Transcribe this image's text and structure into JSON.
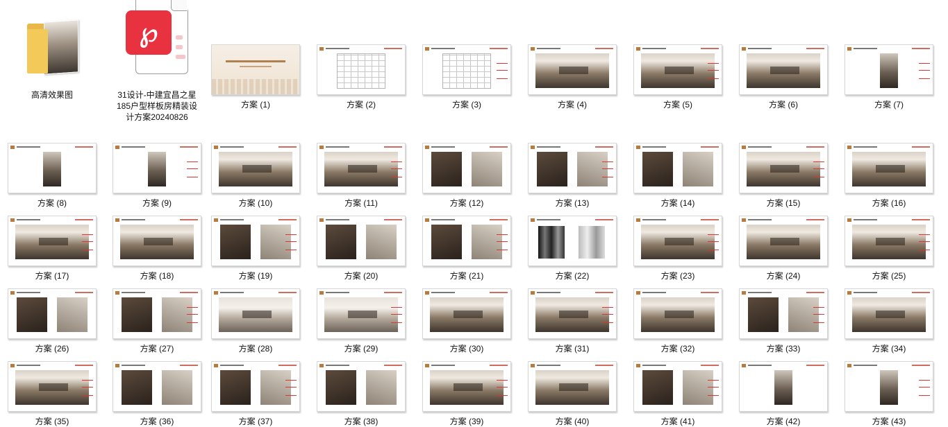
{
  "items": [
    {
      "label": "高清效果图",
      "icon": "folder-icon",
      "kind": "folder"
    },
    {
      "label": "31设计-中建宜昌之星185户型样板房精装设计方案20240826",
      "icon": "pdf-file-icon",
      "kind": "pdf"
    },
    {
      "label": "方案 (1)",
      "kind": "cover"
    },
    {
      "label": "方案 (2)",
      "kind": "plan"
    },
    {
      "label": "方案 (3)",
      "kind": "plan"
    },
    {
      "label": "方案 (4)",
      "kind": "room"
    },
    {
      "label": "方案 (5)",
      "kind": "room"
    },
    {
      "label": "方案 (6)",
      "kind": "room"
    },
    {
      "label": "方案 (7)",
      "kind": "narrow"
    },
    {
      "label": "方案 (8)",
      "kind": "narrow"
    },
    {
      "label": "方案 (9)",
      "kind": "narrow"
    },
    {
      "label": "方案 (10)",
      "kind": "room"
    },
    {
      "label": "方案 (11)",
      "kind": "room"
    },
    {
      "label": "方案 (12)",
      "kind": "twin"
    },
    {
      "label": "方案 (13)",
      "kind": "twin"
    },
    {
      "label": "方案 (14)",
      "kind": "twin"
    },
    {
      "label": "方案 (15)",
      "kind": "room"
    },
    {
      "label": "方案 (16)",
      "kind": "room"
    },
    {
      "label": "方案 (17)",
      "kind": "room"
    },
    {
      "label": "方案 (18)",
      "kind": "room"
    },
    {
      "label": "方案 (19)",
      "kind": "twin"
    },
    {
      "label": "方案 (20)",
      "kind": "twin"
    },
    {
      "label": "方案 (21)",
      "kind": "twin"
    },
    {
      "label": "方案 (22)",
      "kind": "mat"
    },
    {
      "label": "方案 (23)",
      "kind": "room"
    },
    {
      "label": "方案 (24)",
      "kind": "room"
    },
    {
      "label": "方案 (25)",
      "kind": "room"
    },
    {
      "label": "方案 (26)",
      "kind": "twin"
    },
    {
      "label": "方案 (27)",
      "kind": "twin"
    },
    {
      "label": "方案 (28)",
      "kind": "bright"
    },
    {
      "label": "方案 (29)",
      "kind": "bright"
    },
    {
      "label": "方案 (30)",
      "kind": "room"
    },
    {
      "label": "方案 (31)",
      "kind": "room"
    },
    {
      "label": "方案 (32)",
      "kind": "room"
    },
    {
      "label": "方案 (33)",
      "kind": "twin"
    },
    {
      "label": "方案 (34)",
      "kind": "room"
    },
    {
      "label": "方案 (35)",
      "kind": "room"
    },
    {
      "label": "方案 (36)",
      "kind": "twin"
    },
    {
      "label": "方案 (37)",
      "kind": "twin"
    },
    {
      "label": "方案 (38)",
      "kind": "twin"
    },
    {
      "label": "方案 (39)",
      "kind": "room"
    },
    {
      "label": "方案 (40)",
      "kind": "room"
    },
    {
      "label": "方案 (41)",
      "kind": "twin"
    },
    {
      "label": "方案 (42)",
      "kind": "narrow"
    },
    {
      "label": "方案 (43)",
      "kind": "narrow"
    }
  ]
}
